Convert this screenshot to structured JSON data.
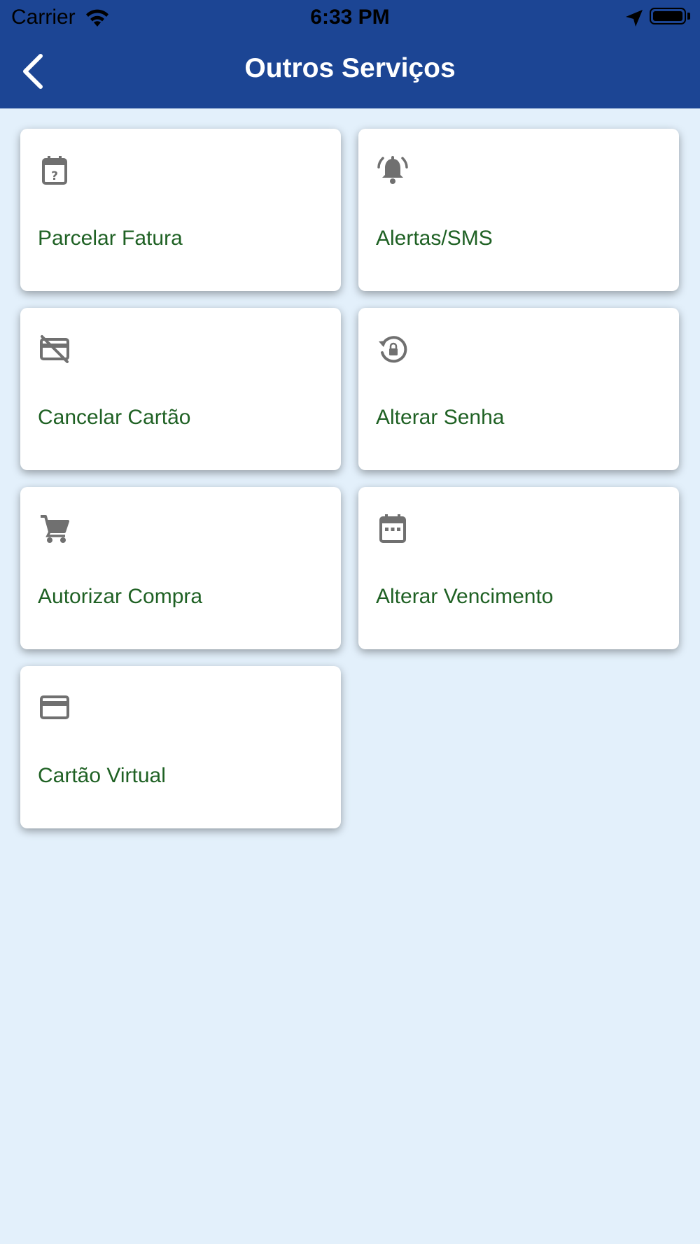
{
  "status_bar": {
    "carrier": "Carrier",
    "time": "6:33 PM"
  },
  "header": {
    "title": "Outros Serviços",
    "background": "#1c4594"
  },
  "colors": {
    "page_background": "#e3f0fb",
    "label_text": "#1f6124",
    "icon": "#707070"
  },
  "services": [
    {
      "label": "Parcelar Fatura",
      "icon": "calendar-question-icon"
    },
    {
      "label": "Alertas/SMS",
      "icon": "alarm-bell-icon"
    },
    {
      "label": "Cancelar Cartão",
      "icon": "card-off-icon"
    },
    {
      "label": "Alterar Senha",
      "icon": "lock-reset-icon"
    },
    {
      "label": "Autorizar Compra",
      "icon": "cart-icon"
    },
    {
      "label": "Alterar Vencimento",
      "icon": "calendar-icon"
    },
    {
      "label": "Cartão Virtual",
      "icon": "credit-card-icon"
    }
  ]
}
